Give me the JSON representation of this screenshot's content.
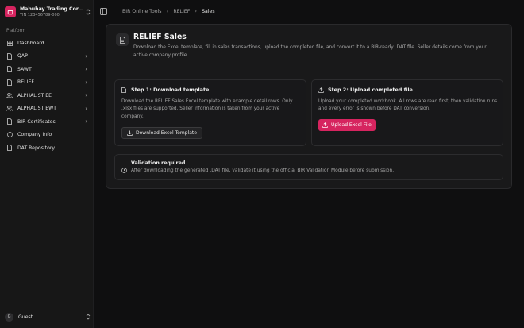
{
  "org": {
    "name": "Mabuhay Trading Corp...",
    "tin": "TIN 123456789-000"
  },
  "sidebar": {
    "section": "Platform",
    "items": [
      {
        "label": "Dashboard",
        "icon": "grid-icon",
        "chevron": false
      },
      {
        "label": "QAP",
        "icon": "doc-icon",
        "chevron": true
      },
      {
        "label": "SAWT",
        "icon": "doc-icon",
        "chevron": true
      },
      {
        "label": "RELIEF",
        "icon": "doc-icon",
        "chevron": true
      },
      {
        "label": "ALPHALIST EE",
        "icon": "users-icon",
        "chevron": true
      },
      {
        "label": "ALPHALIST EWT",
        "icon": "users-icon",
        "chevron": true
      },
      {
        "label": "BIR Certificates",
        "icon": "doc-icon",
        "chevron": true
      },
      {
        "label": "Company Info",
        "icon": "info-icon",
        "chevron": false
      },
      {
        "label": "DAT Repository",
        "icon": "doc-icon",
        "chevron": false
      }
    ],
    "user": {
      "initial": "G",
      "name": "Guest"
    }
  },
  "breadcrumb": [
    "BIR Online Tools",
    "RELIEF",
    "Sales"
  ],
  "page": {
    "title": "RELIEF Sales",
    "subtitle": "Download the Excel template, fill in sales transactions, upload the completed file, and convert it to a BIR-ready .DAT file. Seller details come from your active company profile.",
    "step1": {
      "title": "Step 1: Download template",
      "desc": "Download the RELIEF Sales Excel template with example detail rows. Only .xlsx files are supported. Seller information is taken from your active company.",
      "button": "Download Excel Template"
    },
    "step2": {
      "title": "Step 2: Upload completed file",
      "desc": "Upload your completed workbook. All rows are read first, then validation runs and every error is shown before DAT conversion.",
      "button": "Upload Excel File"
    },
    "validation": {
      "title": "Validation required",
      "desc": "After downloading the generated .DAT file, validate it using the official BIR Validation Module before submission."
    }
  },
  "colors": {
    "accent": "#d6245f",
    "background": "#0f0f10",
    "sidebar": "#171717",
    "card": "#19191a"
  }
}
